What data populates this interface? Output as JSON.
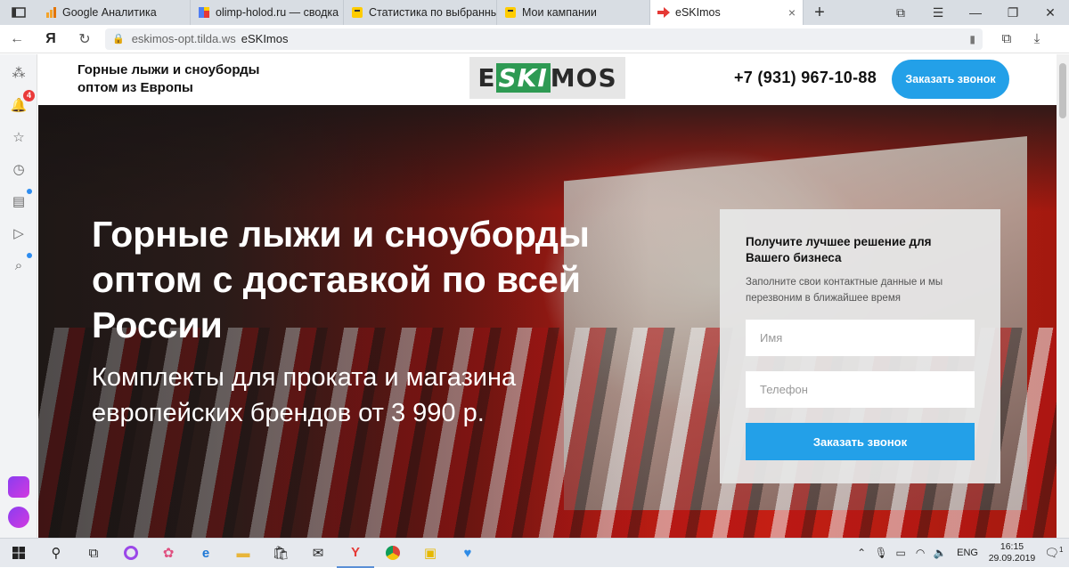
{
  "browser": {
    "tabs": [
      {
        "title": "Google Аналитика",
        "icon": "analytics-icon",
        "color": "#f4a32a",
        "active": false
      },
      {
        "title": "olimp-holod.ru — сводка",
        "icon": "metrika-icon",
        "color": "#e53935",
        "active": false
      },
      {
        "title": "Статистика по выбранны",
        "icon": "direct-icon",
        "color": "#ffcc00",
        "active": false
      },
      {
        "title": "Мои кампании",
        "icon": "direct-icon",
        "color": "#ffcc00",
        "active": false
      },
      {
        "title": "eSKImos",
        "icon": "arrow-icon",
        "color": "#e53935",
        "active": true
      }
    ],
    "url_domain": "eskimos-opt.tilda.ws",
    "page_title": "eSKImos",
    "yandex_glyph": "Я",
    "notification_count": "4"
  },
  "site": {
    "tagline": "Горные лыжи и сноуборды оптом из Европы",
    "logo": {
      "part1": "E",
      "part2": "SKI",
      "part3": "MOS",
      "accent": "#2e9a53"
    },
    "phone": "+7 (931) 967-10-88",
    "header_button": "Заказать звонок",
    "accent_color": "#23a0e8"
  },
  "hero": {
    "title": "Горные лыжи и сноуборды оптом с доставкой по всей России",
    "subtitle": "Комплекты для проката и магазина европейских брендов от 3 990 р."
  },
  "form": {
    "title": "Получите лучшее решение для Вашего бизнеса",
    "description": "Заполните свои контактные данные и мы перезвоним в ближайшее время",
    "name_placeholder": "Имя",
    "phone_placeholder": "Телефон",
    "submit_label": "Заказать звонок"
  },
  "taskbar": {
    "language": "ENG",
    "time": "16:15",
    "date": "29.09.2019",
    "notification_count": "1"
  }
}
